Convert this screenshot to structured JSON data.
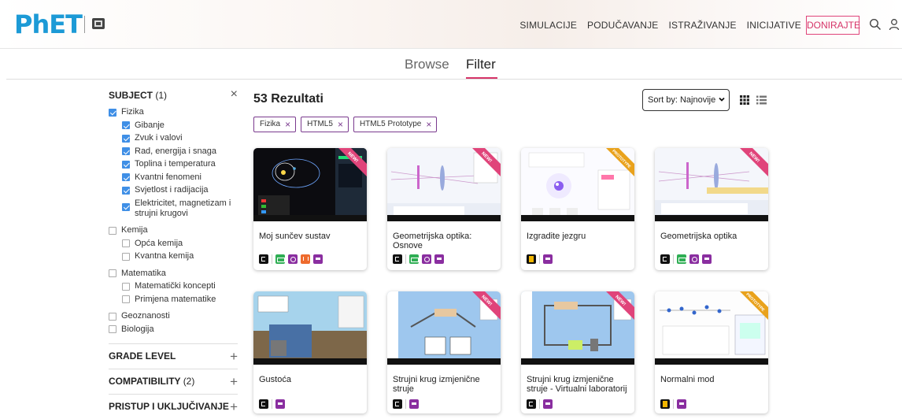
{
  "header": {
    "logo_text": "PhET",
    "nav": [
      "SIMULACIJE",
      "PODUČAVANJE",
      "ISTRAŽIVANJE",
      "INICIJATIVE"
    ],
    "donate_label": "DONIRAJTE",
    "icons": [
      "colorado-university-icon",
      "search-icon",
      "user-icon"
    ]
  },
  "tabs": {
    "browse": "Browse",
    "filter": "Filter",
    "active": "Filter"
  },
  "sidebar": {
    "subject_label": "SUBJECT",
    "subject_count": "(1)",
    "clear_symbol": "×",
    "groups": [
      {
        "label": "Fizika",
        "checked": true,
        "children": [
          {
            "label": "Gibanje",
            "checked": true
          },
          {
            "label": "Zvuk i valovi",
            "checked": true
          },
          {
            "label": "Rad, energija i snaga",
            "checked": true
          },
          {
            "label": "Toplina i temperatura",
            "checked": true
          },
          {
            "label": "Kvantni fenomeni",
            "checked": true
          },
          {
            "label": "Svjetlost i radijacija",
            "checked": true
          },
          {
            "label": "Elektricitet, magnetizam i strujni krugovi",
            "checked": true
          }
        ]
      },
      {
        "label": "Kemija",
        "checked": false,
        "children": [
          {
            "label": "Opća kemija",
            "checked": false
          },
          {
            "label": "Kvantna kemija",
            "checked": false
          }
        ]
      },
      {
        "label": "Matematika",
        "checked": false,
        "children": [
          {
            "label": "Matematički koncepti",
            "checked": false
          },
          {
            "label": "Primjena matematike",
            "checked": false
          }
        ]
      },
      {
        "label": "Geoznanosti",
        "checked": false,
        "children": []
      },
      {
        "label": "Biologija",
        "checked": false,
        "children": []
      }
    ],
    "sections": [
      {
        "label": "GRADE LEVEL",
        "count": "",
        "control": "+"
      },
      {
        "label": "COMPATIBILITY",
        "count": "(2)",
        "control": "+"
      },
      {
        "label": "PRISTUP I UKLJUČIVANJE",
        "count": "",
        "control": "+"
      }
    ]
  },
  "results": {
    "title": "53 Rezultati",
    "sort_label": "Sort by: Najnovije",
    "chips": [
      "Fizika",
      "HTML5",
      "HTML5 Prototype"
    ],
    "chip_close": "×"
  },
  "cards": [
    {
      "title": "Moj sunčev sustav",
      "ribbon": "NEW!",
      "ribbon_color": "#e0447a",
      "thumb": "space",
      "icons": [
        "h5",
        "sep",
        "green",
        "purple",
        "orange",
        "tools"
      ]
    },
    {
      "title": "Geometrijska optika: Osnove",
      "ribbon": "NEW!",
      "ribbon_color": "#e0447a",
      "thumb": "optics",
      "icons": [
        "h5",
        "sep",
        "green",
        "purple",
        "tools"
      ]
    },
    {
      "title": "Izgradite jezgru",
      "ribbon": "PROTOTYPE",
      "ribbon_color": "#e9a21c",
      "thumb": "nucleus",
      "icons": [
        "doc",
        "sep",
        "tools"
      ]
    },
    {
      "title": "Geometrijska optika",
      "ribbon": "NEW!",
      "ribbon_color": "#e0447a",
      "thumb": "optics2",
      "icons": [
        "h5",
        "sep",
        "green",
        "purple",
        "tools"
      ]
    },
    {
      "title": "Gustoća",
      "ribbon": "",
      "ribbon_color": "",
      "thumb": "density",
      "icons": [
        "h5",
        "sep",
        "tools"
      ]
    },
    {
      "title": "Strujni krug izmjenične struje",
      "ribbon": "NEW!",
      "ribbon_color": "#e0447a",
      "thumb": "ac1",
      "icons": [
        "h5",
        "sep",
        "tools"
      ]
    },
    {
      "title": "Strujni krug izmjenične struje - Virtualni laboratorij",
      "ribbon": "NEW!",
      "ribbon_color": "#e0447a",
      "thumb": "ac2",
      "icons": [
        "h5",
        "sep",
        "tools"
      ]
    },
    {
      "title": "Normalni mod",
      "ribbon": "PROTOTYPE",
      "ribbon_color": "#e9a21c",
      "thumb": "normal",
      "icons": [
        "doc",
        "sep",
        "tools"
      ]
    }
  ],
  "colors": {
    "accent": "#d63468",
    "chip_border": "#7a3a8e",
    "checkbox": "#3f8fe6",
    "logo": "#1c9ad6"
  }
}
